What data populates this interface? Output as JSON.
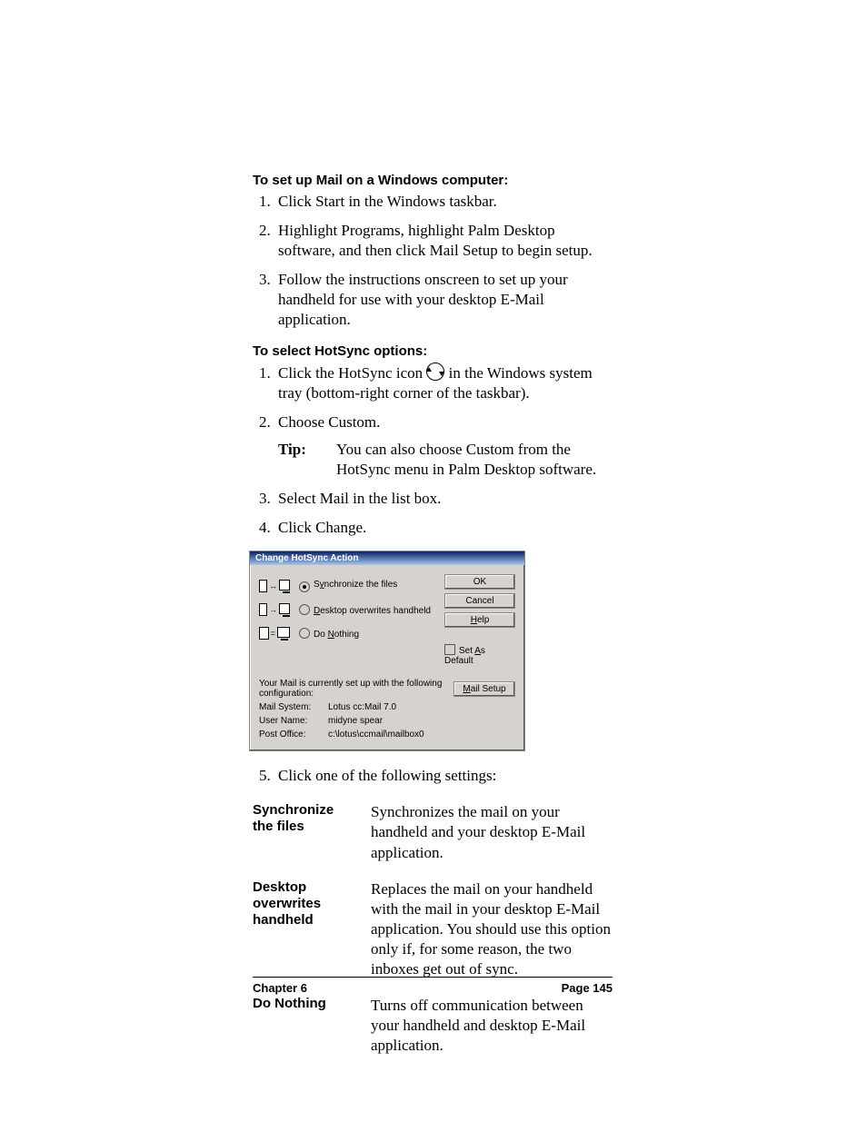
{
  "headings": {
    "setup": "To set up Mail on a Windows computer:",
    "hotsync": "To select HotSync options:"
  },
  "setup_steps": [
    "Click Start in the Windows taskbar.",
    "Highlight Programs, highlight Palm Desktop software, and then click Mail Setup to begin setup.",
    "Follow the instructions onscreen to set up your handheld for use with your desktop E-Mail application."
  ],
  "hotsync_steps": {
    "s1a": "Click the HotSync icon ",
    "s1b": " in the Windows system tray (bottom-right corner of the taskbar).",
    "s2": "Choose Custom.",
    "tip_label": "Tip:",
    "tip_text": "You can also choose Custom from the HotSync menu in Palm Desktop software.",
    "s3": "Select Mail in the list box.",
    "s4": "Click Change.",
    "s5": "Click one of the following settings:"
  },
  "dialog": {
    "title": "Change HotSync Action",
    "opt1_pre": "S",
    "opt1_und": "y",
    "opt1_post": "nchronize the files",
    "opt2_pre": "",
    "opt2_und": "D",
    "opt2_post": "esktop overwrites handheld",
    "opt3_pre": "Do ",
    "opt3_und": "N",
    "opt3_post": "othing",
    "btn_ok": "OK",
    "btn_cancel": "Cancel",
    "btn_help_pre": "",
    "btn_help_und": "H",
    "btn_help_post": "elp",
    "setdef_pre": "Set ",
    "setdef_und": "A",
    "setdef_post": "s Default",
    "conf_text": "Your Mail is currently set up with the following configuration:",
    "btn_ms_pre": "",
    "btn_ms_und": "M",
    "btn_ms_post": "ail Setup",
    "kv": [
      {
        "k": "Mail System:",
        "v": "Lotus cc:Mail 7.0"
      },
      {
        "k": "User Name:",
        "v": "midyne spear"
      },
      {
        "k": "Post Office:",
        "v": "c:\\lotus\\ccmail\\mailbox0"
      }
    ]
  },
  "settings": [
    {
      "label": "Synchronize the files",
      "desc": "Synchronizes the mail on your handheld and your desktop E-Mail application."
    },
    {
      "label": "Desktop overwrites handheld",
      "desc": "Replaces the mail on your handheld with the mail in your desktop E-Mail application. You should use this option only if, for some reason, the two inboxes get out of sync."
    },
    {
      "label": "Do Nothing",
      "desc": "Turns off communication between your handheld and desktop E-Mail application."
    }
  ],
  "footer": {
    "left": "Chapter 6",
    "right": "Page 145"
  }
}
